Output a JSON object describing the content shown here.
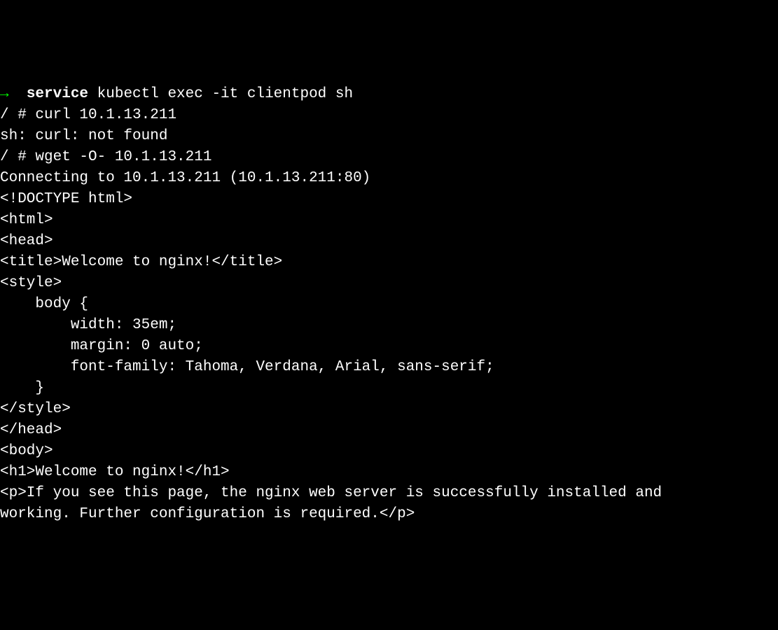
{
  "terminal": {
    "line1_arrow": "→",
    "line1_bold": "  service",
    "line1_rest": " kubectl exec -it clientpod sh",
    "line2": "/ # curl 10.1.13.211",
    "line3": "sh: curl: not found",
    "line4": "/ # wget -O- 10.1.13.211",
    "line5": "Connecting to 10.1.13.211 (10.1.13.211:80)",
    "line6": "<!DOCTYPE html>",
    "line7": "<html>",
    "line8": "<head>",
    "line9": "<title>Welcome to nginx!</title>",
    "line10": "<style>",
    "line11": "    body {",
    "line12": "        width: 35em;",
    "line13": "        margin: 0 auto;",
    "line14": "        font-family: Tahoma, Verdana, Arial, sans-serif;",
    "line15": "    }",
    "line16": "</style>",
    "line17": "</head>",
    "line18": "<body>",
    "line19": "<h1>Welcome to nginx!</h1>",
    "line20": "<p>If you see this page, the nginx web server is successfully installed and",
    "line21": "working. Further configuration is required.</p>"
  }
}
